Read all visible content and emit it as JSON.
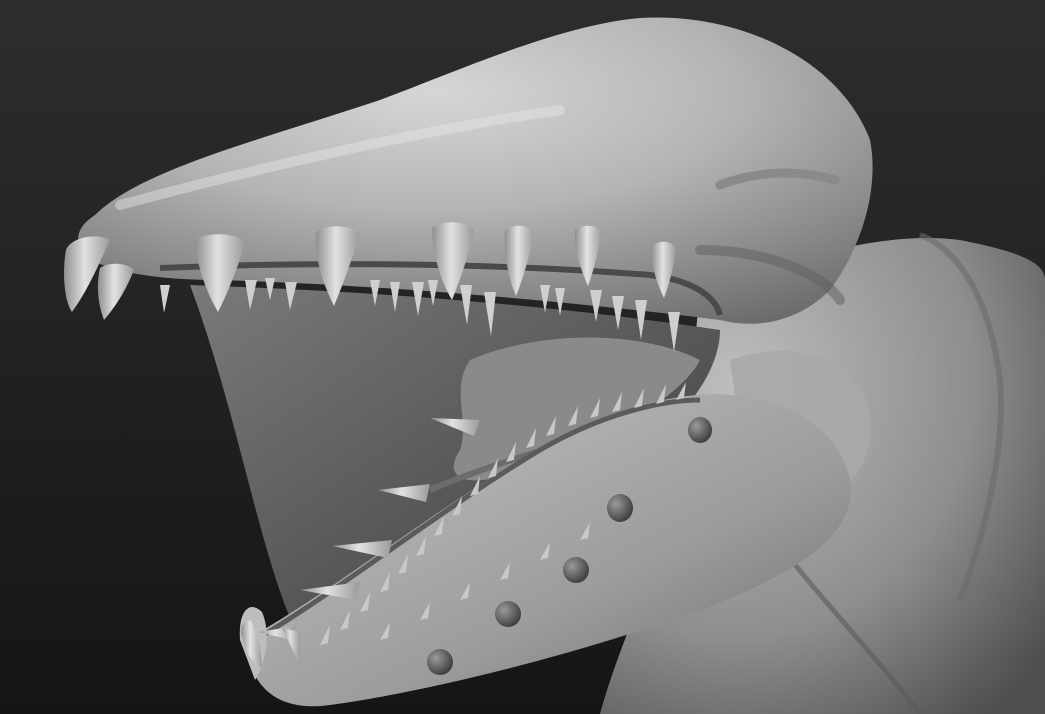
{
  "scene": {
    "subject": "creature-head-sculpt",
    "colors": {
      "background_top": "#2d2d2d",
      "background_bottom": "#151515",
      "clay_light": "#cfcfcf",
      "clay_mid": "#a3a3a3",
      "clay_dark": "#5e5e5e",
      "mouth_interior": "#4a4a4a"
    }
  }
}
